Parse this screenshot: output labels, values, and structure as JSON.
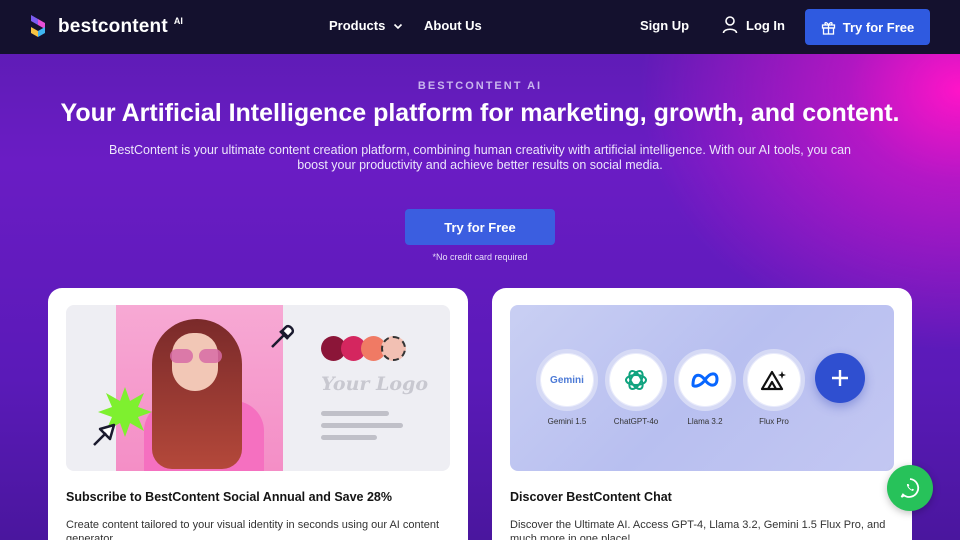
{
  "nav": {
    "brand": "bestcontent",
    "brand_suffix": "AI",
    "products_label": "Products",
    "about_label": "About Us",
    "signup_label": "Sign Up",
    "login_label": "Log In",
    "try_label": "Try for Free"
  },
  "hero": {
    "eyebrow": "BESTCONTENT AI",
    "headline": "Your Artificial Intelligence platform for marketing, growth, and content.",
    "subtext": "BestContent is your ultimate content creation platform, combining human creativity with artificial intelligence. With our AI tools, you can boost your productivity and achieve better results on social media.",
    "cta_label": "Try for Free",
    "cta_note": "*No credit card required"
  },
  "cards": [
    {
      "title": "Subscribe to BestContent Social Annual and Save 28%",
      "description": "Create content tailored to your visual identity in seconds using our AI content generator",
      "media": {
        "logo_placeholder": "Your Logo",
        "swatch_colors": [
          "#8b1538",
          "#d4265f",
          "#f07a64",
          "#f2c0b3"
        ]
      }
    },
    {
      "title": "Discover BestContent Chat",
      "description": "Discover the Ultimate AI. Access GPT-4, Llama 3.2, Gemini 1.5 Flux Pro, and much more in one place!",
      "media": {
        "models": [
          {
            "label": "Gemini 1.5",
            "icon": "gemini-icon",
            "logo_text": "Gemini"
          },
          {
            "label": "ChatGPT-4o",
            "icon": "openai-icon"
          },
          {
            "label": "Llama 3.2",
            "icon": "meta-icon"
          },
          {
            "label": "Flux Pro",
            "icon": "flux-icon"
          }
        ]
      }
    }
  ],
  "colors": {
    "nav_bg": "#14112e",
    "primary_button": "#2f5ae0",
    "whatsapp": "#27c25a"
  }
}
